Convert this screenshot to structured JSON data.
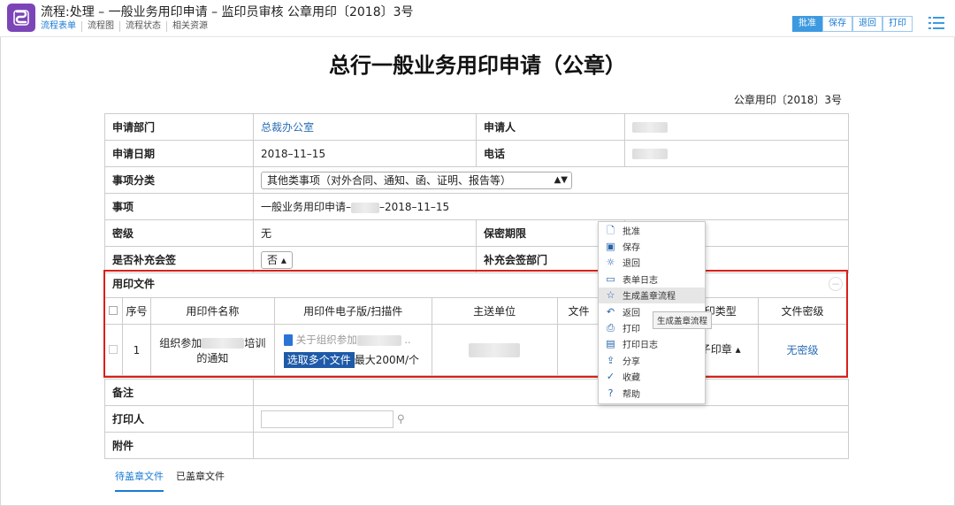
{
  "window": {
    "title": "流程:处理 – 一般业务用印申请 – 监印员审核 公章用印〔2018〕3号",
    "tabs": [
      "流程表单",
      "流程图",
      "流程状态",
      "相关资源"
    ],
    "toolbar": {
      "approve": "批准",
      "save": "保存",
      "reject": "退回",
      "print": "打印"
    }
  },
  "document": {
    "title": "总行一般业务用印申请（公章）",
    "number": "公章用印〔2018〕3号"
  },
  "form": {
    "dept_label": "申请部门",
    "dept_value": "总裁办公室",
    "applicant_label": "申请人",
    "date_label": "申请日期",
    "date_value": "2018–11–15",
    "phone_label": "电话",
    "category_label": "事项分类",
    "category_value": "其他类事项（对外合同、通知、函、证明、报告等）",
    "item_label": "事项",
    "item_value_prefix": "一般业务用印申请–",
    "item_value_suffix": "–2018–11–15",
    "secret_label": "密级",
    "secret_value": "无",
    "period_label": "保密期限",
    "extra_sign_label": "是否补充会签",
    "extra_sign_value": "否",
    "extra_dept_label": "补充会签部门",
    "remark_label": "备注",
    "printer_label": "打印人",
    "attach_label": "附件"
  },
  "seal_files": {
    "section_title": "用印文件",
    "headers": [
      "序号",
      "用印件名称",
      "用印件电子版/扫描件",
      "主送单位",
      "文件",
      "用印类型",
      "文件密级"
    ],
    "row": {
      "index": "1",
      "name_prefix": "组织参加",
      "name_suffix": "培训",
      "name_line2": "的通知",
      "file_prefix": "关于组织参加",
      "upload_button": "选取多个文件",
      "upload_hint": "最大200M/个",
      "seal_type": "电子印章",
      "level": "无密级"
    }
  },
  "context_menu": {
    "items": [
      {
        "label": "批准",
        "icon": "document-icon"
      },
      {
        "label": "保存",
        "icon": "save-icon"
      },
      {
        "label": "退回",
        "icon": "sun-icon"
      },
      {
        "label": "表单日志",
        "icon": "log-icon"
      },
      {
        "label": "生成盖章流程",
        "icon": "star-icon"
      },
      {
        "label": "返回",
        "icon": "undo-icon"
      },
      {
        "label": "打印",
        "icon": "printer-icon"
      },
      {
        "label": "打印日志",
        "icon": "window-icon"
      },
      {
        "label": "分享",
        "icon": "share-icon"
      },
      {
        "label": "收藏",
        "icon": "check-icon"
      },
      {
        "label": "帮助",
        "icon": "help-icon"
      }
    ],
    "highlight_index": 4,
    "tooltip": "生成盖章流程"
  },
  "bottom_tabs": [
    "待盖章文件",
    "已盖章文件"
  ],
  "colors": {
    "accent": "#3d9ae0",
    "logo": "#7b45b8",
    "highlight_box": "#d9201a"
  }
}
